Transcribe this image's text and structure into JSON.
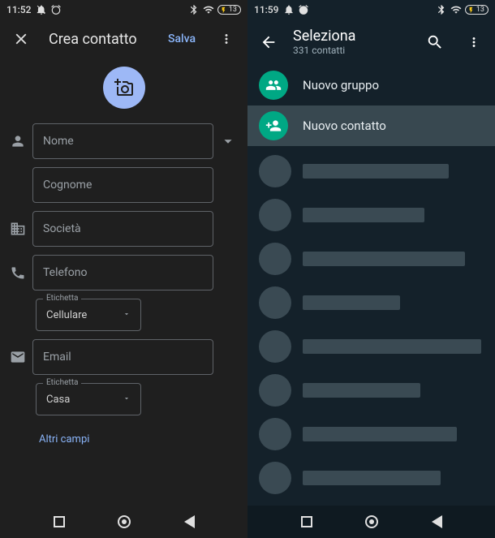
{
  "left": {
    "status": {
      "time": "11:52",
      "battery": "13"
    },
    "appbar": {
      "title": "Crea contatto",
      "save": "Salva"
    },
    "fields": {
      "name": "Nome",
      "surname": "Cognome",
      "company": "Società",
      "phone": "Telefono",
      "phone_label_legend": "Etichetta",
      "phone_label_value": "Cellulare",
      "email": "Email",
      "email_label_legend": "Etichetta",
      "email_label_value": "Casa"
    },
    "more_fields": "Altri campi"
  },
  "right": {
    "status": {
      "time": "11:59",
      "battery": "13"
    },
    "appbar": {
      "title": "Seleziona",
      "subtitle": "331 contatti"
    },
    "actions": {
      "new_group": "Nuovo gruppo",
      "new_contact": "Nuovo contatto"
    },
    "placeholder_widths": [
      180,
      150,
      200,
      120,
      220,
      145,
      190,
      170,
      200
    ]
  }
}
